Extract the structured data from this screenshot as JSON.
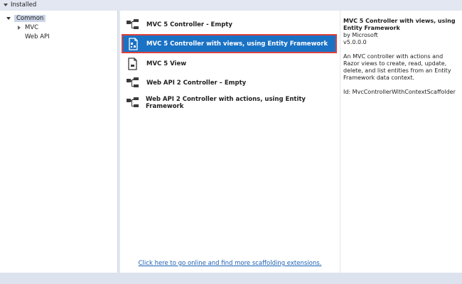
{
  "header": {
    "label": "Installed"
  },
  "tree": {
    "items": [
      {
        "label": "Common",
        "state": "expanded",
        "selected": true
      },
      {
        "label": "MVC",
        "state": "collapsed"
      },
      {
        "label": "Web API",
        "state": "none"
      }
    ]
  },
  "templates": [
    {
      "label": "MVC 5 Controller - Empty",
      "icon": "controller-icon"
    },
    {
      "label": "MVC 5 Controller with views, using Entity Framework",
      "icon": "controller-views-icon",
      "selected": true
    },
    {
      "label": "MVC 5 View",
      "icon": "view-file-icon"
    },
    {
      "label": "Web API 2 Controller – Empty",
      "icon": "controller-icon"
    },
    {
      "label": "Web API 2 Controller with actions, using Entity Framework",
      "icon": "controller-icon"
    }
  ],
  "online_link": "Click here to go online and find more scaffolding extensions.",
  "details": {
    "title": "MVC 5 Controller with views, using Entity Framework",
    "author": "by Microsoft",
    "version": "v5.0.0.0",
    "description": "An MVC controller with actions and Razor views to create, read, update, delete, and list entities from an Entity Framework data context.",
    "id": "Id: MvcControllerWithContextScaffolder"
  },
  "colors": {
    "selection": "#1a72c5",
    "selection_border": "#e0403c",
    "link": "#1a5fb4"
  }
}
